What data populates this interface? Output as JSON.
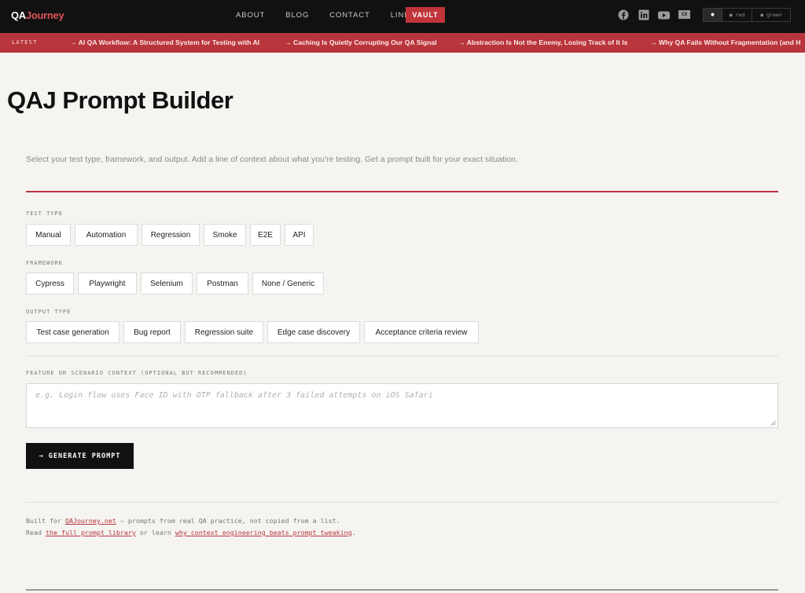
{
  "header": {
    "logo_prefix": "QA",
    "logo_suffix": "Journey",
    "nav": [
      "ABOUT",
      "BLOG",
      "CONTACT",
      "LINKS"
    ],
    "vault_label": "VAULT",
    "cv_label": "CV",
    "themes": {
      "active": "✸",
      "red": "● red",
      "green": "● green"
    },
    "social_icons": [
      "facebook-icon",
      "linkedin-icon",
      "youtube-icon"
    ]
  },
  "ticker": {
    "label": "LATEST",
    "items": [
      "→ AI QA Workflow: A Structured System for Testing with AI",
      "→ Caching Is Quietly Corrupting Our QA Signal",
      "→ Abstraction Is Not the Enemy, Losing Track of It Is",
      "→ Why QA Fails Without Fragmentation (and H"
    ]
  },
  "main": {
    "title": "QAJ Prompt Builder",
    "intro": "Select your test type, framework, and output. Add a line of context about what you're testing. Get a prompt built for your exact situation.",
    "test_type": {
      "label": "TEST TYPE",
      "options": [
        "Manual",
        "Automation",
        "Regression",
        "Smoke",
        "E2E",
        "API"
      ]
    },
    "framework": {
      "label": "FRAMEWORK",
      "options": [
        "Cypress",
        "Playwright",
        "Selenium",
        "Postman",
        "None / Generic"
      ]
    },
    "output_type": {
      "label": "OUTPUT TYPE",
      "options": [
        "Test case generation",
        "Bug report",
        "Regression suite",
        "Edge case discovery",
        "Acceptance criteria review"
      ]
    },
    "context": {
      "label": "FEATURE OR SCENARIO CONTEXT (OPTIONAL BUT RECOMMENDED)",
      "placeholder": "e.g. Login flow uses Face ID with OTP fallback after 3 failed attempts on iOS Safari",
      "value": ""
    },
    "generate_label": "→ GENERATE PROMPT"
  },
  "footer": {
    "line1_prefix": "Built for ",
    "line1_link": "QAJourney.net",
    "line1_suffix": " — prompts from real QA practice, not copied from a list.",
    "line2_prefix": "Read ",
    "line2_link1": "the full prompt library",
    "line2_middle": " or learn ",
    "line2_link2": "why context engineering beats prompt tweaking",
    "line2_suffix": "."
  },
  "colors": {
    "accent": "#b8353b",
    "vault": "#c0343a",
    "nav_bg": "#111111",
    "page_bg": "#f5f4f1"
  }
}
